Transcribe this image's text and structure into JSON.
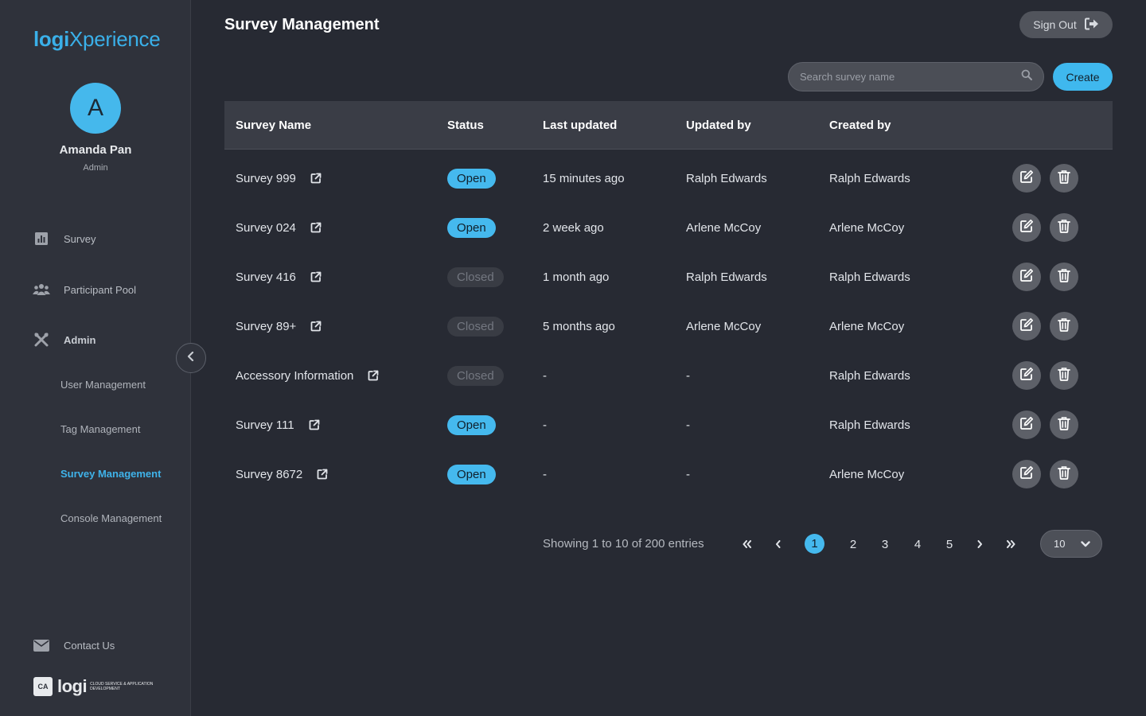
{
  "app": {
    "logo_left": "logi",
    "logo_right": "Xperience",
    "footer_logo": "logi",
    "footer_tagline": "CLOUD SERVICE & APPLICATION DEVELOPMENT",
    "footer_mark": "CA"
  },
  "user": {
    "initial": "A",
    "name": "Amanda Pan",
    "role": "Admin"
  },
  "nav": {
    "survey": "Survey",
    "participant_pool": "Participant Pool",
    "admin": "Admin",
    "sub": [
      "User Management",
      "Tag Management",
      "Survey Management",
      "Console Management"
    ],
    "contact": "Contact Us"
  },
  "header": {
    "title": "Survey Management",
    "sign_out": "Sign Out"
  },
  "toolbar": {
    "search_placeholder": "Search survey name",
    "create": "Create"
  },
  "table": {
    "columns": [
      "Survey Name",
      "Status",
      "Last updated",
      "Updated by",
      "Created by"
    ],
    "rows": [
      {
        "name": "Survey 999",
        "status": "Open",
        "updated": "15 minutes ago",
        "updated_by": "Ralph Edwards",
        "created_by": "Ralph Edwards"
      },
      {
        "name": "Survey 024",
        "status": "Open",
        "updated": "2 week ago",
        "updated_by": "Arlene McCoy",
        "created_by": "Arlene McCoy"
      },
      {
        "name": "Survey 416",
        "status": "Closed",
        "updated": "1 month ago",
        "updated_by": "Ralph Edwards",
        "created_by": "Ralph Edwards"
      },
      {
        "name": "Survey 89+",
        "status": "Closed",
        "updated": "5 months ago",
        "updated_by": "Arlene McCoy",
        "created_by": "Arlene McCoy"
      },
      {
        "name": "Accessory Information",
        "status": "Closed",
        "updated": "-",
        "updated_by": "-",
        "created_by": "Ralph Edwards"
      },
      {
        "name": "Survey 111",
        "status": "Open",
        "updated": "-",
        "updated_by": "-",
        "created_by": "Ralph Edwards"
      },
      {
        "name": "Survey 8672",
        "status": "Open",
        "updated": "-",
        "updated_by": "-",
        "created_by": "Arlene McCoy"
      }
    ]
  },
  "pagination": {
    "info": "Showing 1 to 10 of 200 entries",
    "pages": [
      "1",
      "2",
      "3",
      "4",
      "5"
    ],
    "current": "1",
    "page_size": "10"
  },
  "colors": {
    "accent": "#45b9ee",
    "background": "#272a33",
    "sidebar": "#2f323b"
  }
}
